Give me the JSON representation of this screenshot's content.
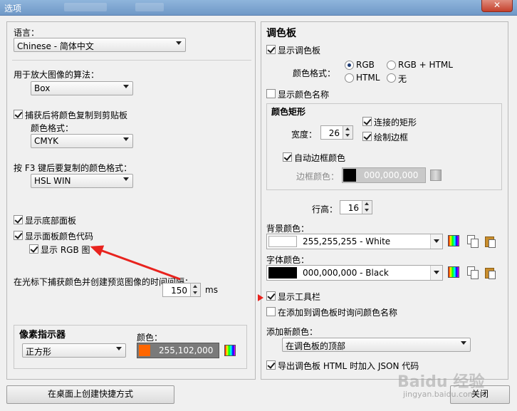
{
  "window": {
    "title": "选项",
    "close_label": "✕"
  },
  "left": {
    "language": {
      "label": "语言：",
      "value": "Chinese - 简体中文"
    },
    "algo": {
      "label": "用于放大图像的算法：",
      "value": "Box"
    },
    "copy_after": {
      "label": "捕获后将颜色复制到剪贴板",
      "checked": true,
      "format_label": "颜色格式：",
      "format_value": "CMYK"
    },
    "f3": {
      "label": "按 F3 键后要复制的颜色格式：",
      "value": "HSL WIN"
    },
    "show_bottom": {
      "label": "显示底部面板",
      "checked": true
    },
    "show_code": {
      "label": "显示面板颜色代码",
      "checked": true
    },
    "show_rgb": {
      "label": "显示 RGB 图",
      "checked": true
    },
    "interval": {
      "label": "在光标下捕获颜色并创建预览图像的时间间隔：",
      "value": "150",
      "unit": "ms"
    },
    "pixel": {
      "title": "像素指示器",
      "shape": "正方形",
      "color_label": "颜色：",
      "color_value": "255,102,000",
      "color_hex": "#ff6600"
    },
    "shortcut_button": "在桌面上创建快捷方式"
  },
  "right": {
    "title": "调色板",
    "show_palette": {
      "label": "显示调色板",
      "checked": true
    },
    "format_label": "颜色格式：",
    "radios": [
      {
        "label": "RGB",
        "on": true
      },
      {
        "label": "RGB + HTML",
        "on": false
      },
      {
        "label": "HTML",
        "on": false
      },
      {
        "label": "无",
        "on": false
      }
    ],
    "show_names": {
      "label": "显示颜色名称",
      "checked": false
    },
    "rect": {
      "title": "颜色矩形",
      "width_label": "宽度：",
      "width_value": "26",
      "connected": "连接的矩形",
      "draw_border": "绘制边框",
      "auto_border": "自动边框颜色",
      "border_label": "边框颜色：",
      "border_value": "000,000,000"
    },
    "row_height": {
      "label": "行高：",
      "value": "16"
    },
    "bg": {
      "label": "背景颜色：",
      "value": "255,255,255  -  White",
      "hex": "#ffffff"
    },
    "fg": {
      "label": "字体颜色：",
      "value": "000,000,000  -  Black",
      "hex": "#000000"
    },
    "show_toolbar": {
      "label": "显示工具栏",
      "checked": true
    },
    "ask_name": {
      "label": "在添加到调色板时询问颜色名称",
      "checked": false
    },
    "add_new": {
      "label": "添加新颜色：",
      "value": "在调色板的顶部"
    },
    "export_json": {
      "label": "导出调色板 HTML 时加入 JSON 代码",
      "checked": true
    },
    "close_button": "关闭"
  },
  "watermark": {
    "brand": "Baidu 经验",
    "url": "jingyan.baidu.com"
  },
  "colors": {
    "accent_arrow": "#e8231e"
  }
}
